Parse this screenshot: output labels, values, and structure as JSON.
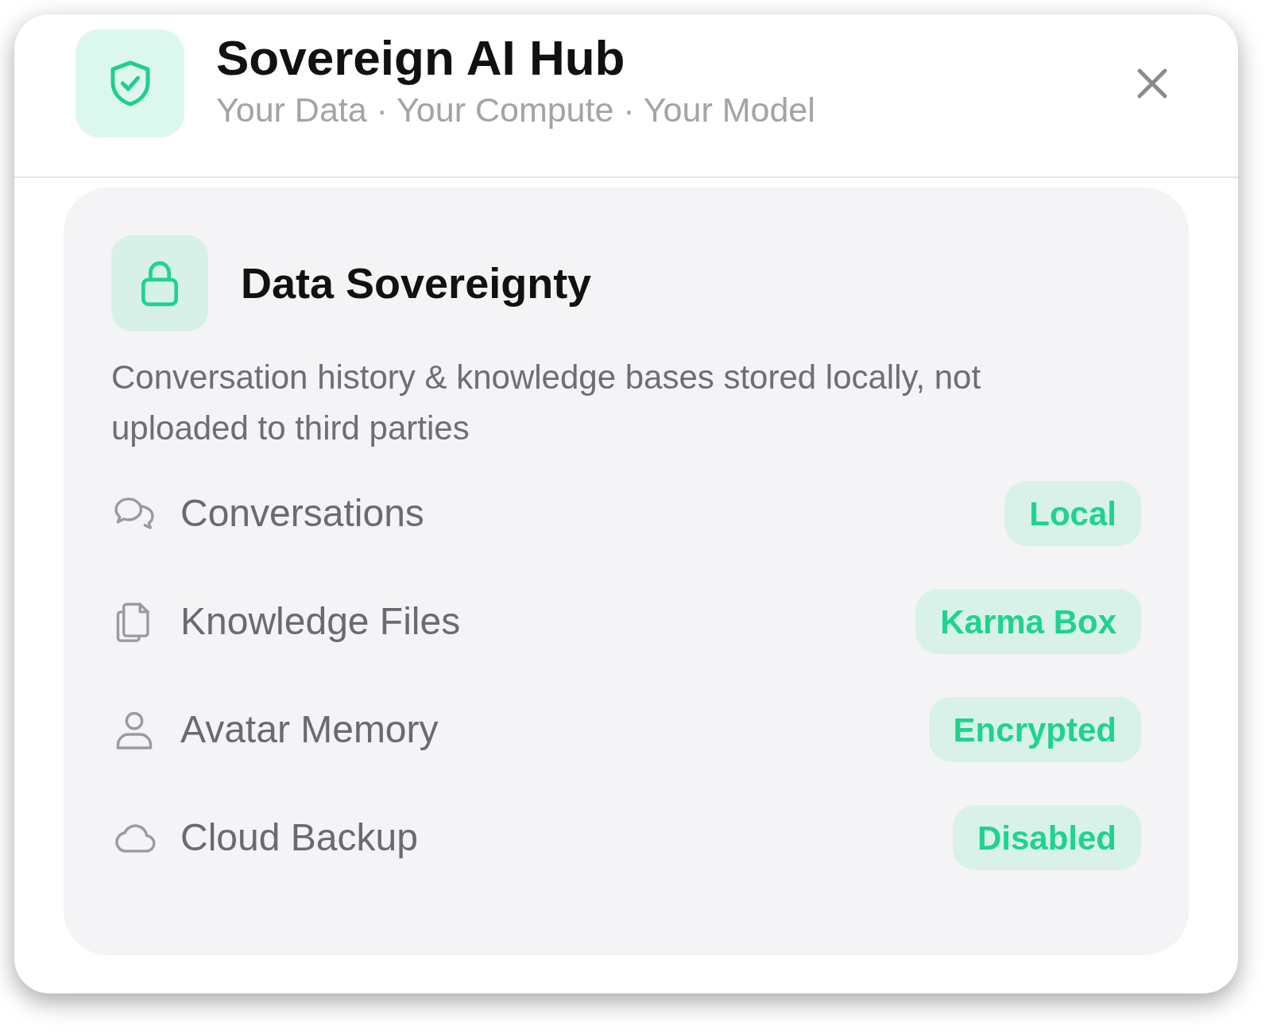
{
  "header": {
    "title": "Sovereign AI Hub",
    "subtitle": "Your Data · Your Compute · Your Model"
  },
  "section": {
    "title": "Data Sovereignty",
    "description": "Conversation history & knowledge bases stored locally, not uploaded to third parties",
    "items": [
      {
        "kind": "chat",
        "label": "Conversations",
        "status": "Local"
      },
      {
        "kind": "files",
        "label": "Knowledge Files",
        "status": "Karma Box"
      },
      {
        "kind": "person",
        "label": "Avatar Memory",
        "status": "Encrypted"
      },
      {
        "kind": "cloud",
        "label": "Cloud Backup",
        "status": "Disabled"
      }
    ]
  }
}
